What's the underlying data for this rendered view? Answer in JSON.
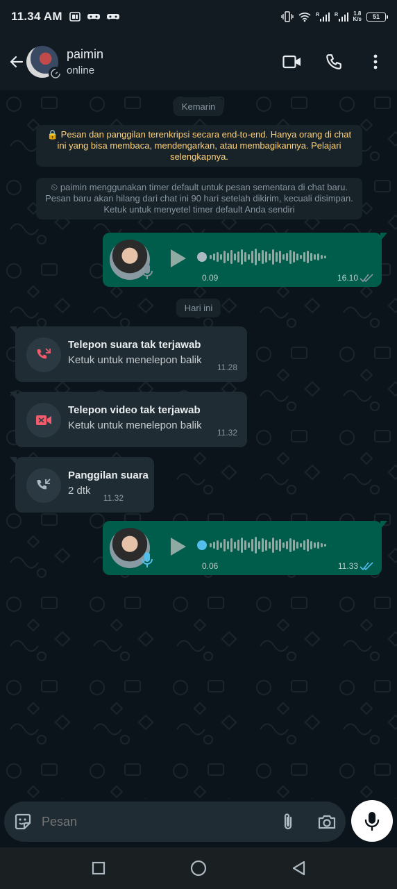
{
  "status_bar": {
    "time": "11.34 AM",
    "speed_top": "1.8",
    "speed_bottom": "K/s",
    "battery": "51"
  },
  "header": {
    "name": "paimin",
    "status": "online"
  },
  "chat": {
    "date_1": "Kemarin",
    "encryption_note": "🔒 Pesan dan panggilan terenkripsi secara end-to-end. Hanya orang di chat ini yang bisa membaca, mendengarkan, atau membagikannya. Pelajari selengkapnya.",
    "timer_note": "⏲ paimin menggunakan timer default untuk pesan sementara di chat baru. Pesan baru akan hilang dari chat ini 90 hari setelah dikirim, kecuali disimpan. Ketuk untuk menyetel timer default Anda sendiri",
    "voice_note_1": {
      "duration": "0.09",
      "time": "16.10"
    },
    "date_2": "Hari ini",
    "calls": [
      {
        "title": "Telepon suara tak terjawab",
        "subtitle": "Ketuk untuk menelepon balik",
        "time": "11.28",
        "icon": "missed-voice-call-icon"
      },
      {
        "title": "Telepon video tak terjawab",
        "subtitle": "Ketuk untuk menelepon balik",
        "time": "11.32",
        "icon": "missed-video-call-icon"
      },
      {
        "title": "Panggilan suara",
        "subtitle": "2 dtk",
        "time": "11.32",
        "icon": "incoming-voice-call-icon"
      }
    ],
    "voice_note_2": {
      "duration": "0.06",
      "time": "11.33"
    }
  },
  "composer": {
    "placeholder": "Pesan"
  },
  "colors": {
    "outgoing": "#005c4b",
    "incoming": "#202c33",
    "missed": "#f15c6d",
    "tick_read": "#53bdeb",
    "encryption": "#ffd279"
  }
}
